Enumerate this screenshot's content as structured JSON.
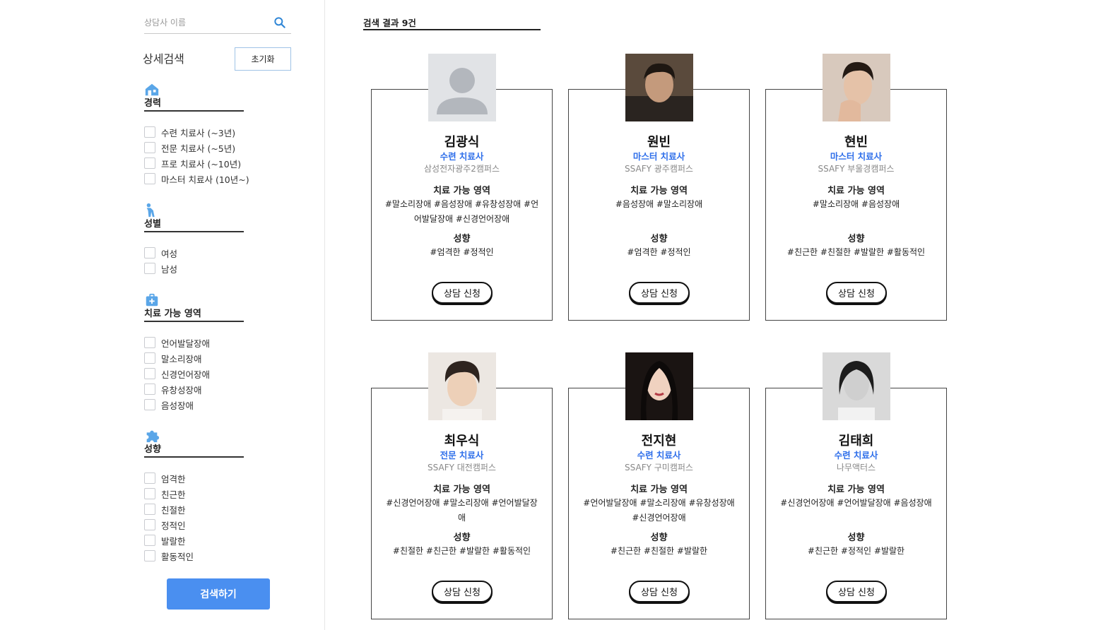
{
  "search": {
    "placeholder": "상담사 이름",
    "icon": "search-icon"
  },
  "detail": {
    "title": "상세검색",
    "reset_label": "초기화"
  },
  "filters": {
    "career": {
      "label": "경력",
      "icon": "house-icon",
      "options": [
        "수련 치료사 (~3년)",
        "전문 치료사 (~5년)",
        "프로 치료사 (~10년)",
        "마스터 치료사 (10년~)"
      ]
    },
    "gender": {
      "label": "성별",
      "icon": "person-icon",
      "options": [
        "여성",
        "남성"
      ]
    },
    "area": {
      "label": "치료 가능 영역",
      "icon": "medical-kit-icon",
      "options": [
        "언어발달장애",
        "말소리장애",
        "신경언어장애",
        "유창성장애",
        "음성장애"
      ]
    },
    "tendency": {
      "label": "성향",
      "icon": "puzzle-icon",
      "options": [
        "엄격한",
        "친근한",
        "친절한",
        "정적인",
        "발랄한",
        "활동적인"
      ]
    }
  },
  "submit_label": "검색하기",
  "result": {
    "heading": "검색 결과 9건"
  },
  "card_labels": {
    "area_title": "치료 가능 영역",
    "tendency_title": "성향",
    "apply_label": "상담 신청"
  },
  "counselors": [
    {
      "name": "김광식",
      "level": "수련 치료사",
      "org": "삼성전자광주2캠퍼스",
      "areas": "#말소리장애 #음성장애 #유창성장애 #언어발달장애 #신경언어장애",
      "tendency": "#엄격한 #정적인",
      "photo": "default-avatar"
    },
    {
      "name": "원빈",
      "level": "마스터 치료사",
      "org": "SSAFY 광주캠퍼스",
      "areas": "#음성장애 #말소리장애",
      "tendency": "#엄격한 #정적인",
      "photo": "man-photo"
    },
    {
      "name": "현빈",
      "level": "마스터 치료사",
      "org": "SSAFY 부울경캠퍼스",
      "areas": "#말소리장애 #음성장애",
      "tendency": "#친근한 #친절한 #발랄한 #활동적인",
      "photo": "man-photo"
    },
    {
      "name": "최우식",
      "level": "전문 치료사",
      "org": "SSAFY 대전캠퍼스",
      "areas": "#신경언어장애 #말소리장애 #언어발달장애",
      "tendency": "#친절한 #친근한 #발랄한 #활동적인",
      "photo": "man-photo"
    },
    {
      "name": "전지현",
      "level": "수련 치료사",
      "org": "SSAFY 구미캠퍼스",
      "areas": "#언어발달장애 #말소리장애 #유창성장애 #신경언어장애",
      "tendency": "#친근한 #친절한 #발랄한",
      "photo": "woman-photo"
    },
    {
      "name": "김태희",
      "level": "수련 치료사",
      "org": "나무액터스",
      "areas": "#신경언어장애 #언어발달장애 #음성장애",
      "tendency": "#친근한 #정적인 #발랄한",
      "photo": "woman-photo"
    }
  ],
  "colors": {
    "accent": "#4a8ff0",
    "level_text": "#2f6fea",
    "icon": "#5aa6e8"
  }
}
